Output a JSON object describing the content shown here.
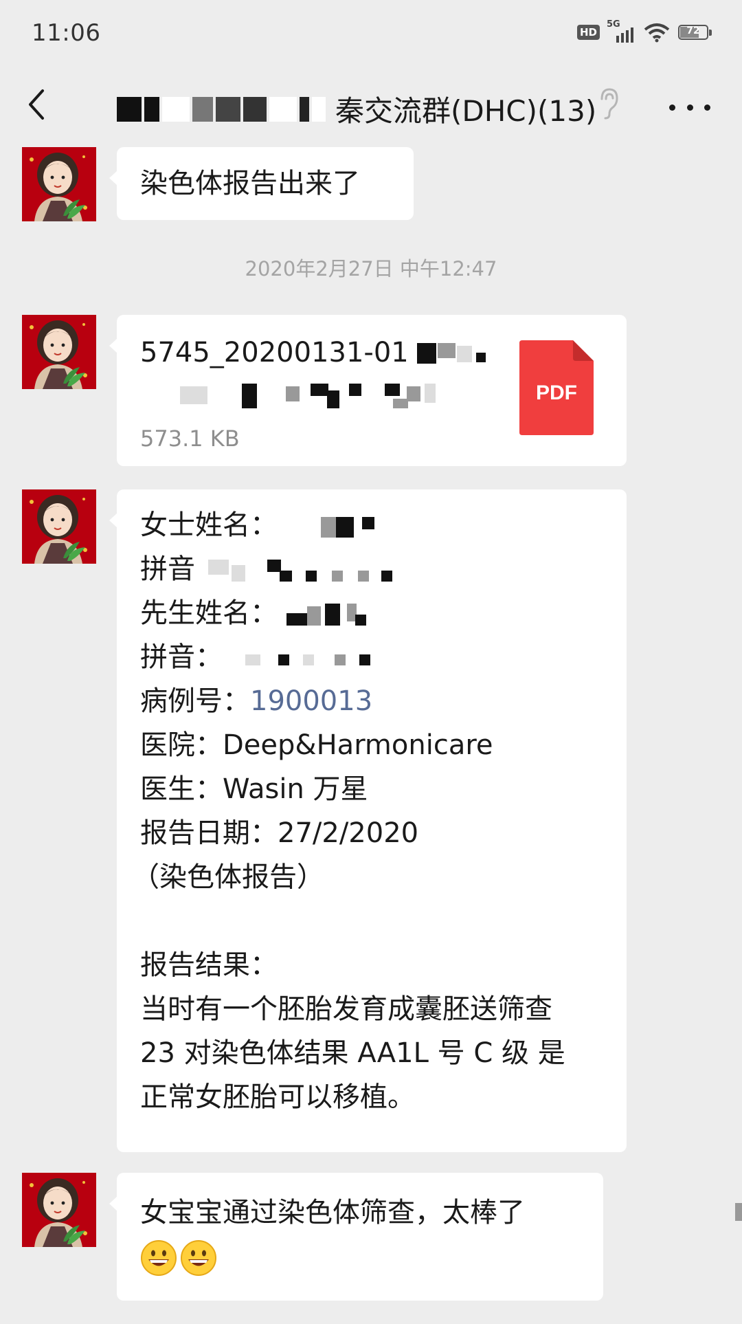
{
  "status_bar": {
    "time": "11:06",
    "hd_badge": "HD",
    "network": "5G",
    "battery_level": "72",
    "battery_fraction": 0.72
  },
  "nav": {
    "title_visible": "秦交流群(DHC)(13)",
    "back_icon": "chevron-left-icon",
    "ear_icon": "ear-icon",
    "more_icon": "more-dots-icon"
  },
  "messages": [
    {
      "type": "text",
      "text": "染色体报告出来了"
    },
    {
      "type": "timestamp",
      "text": "2020年2月27日 中午12:47"
    },
    {
      "type": "file",
      "file_name": "5745_20200131-01",
      "file_size": "573.1 KB",
      "file_type": "PDF"
    },
    {
      "type": "report",
      "lines": {
        "female_name_label": "女士姓名：",
        "pinyin1_label": "拼音",
        "male_name_label": "先生姓名：",
        "pinyin2_label": "拼音：",
        "case_label": "病例号：",
        "case_number": "1900013",
        "hospital": "医院：Deep&Harmonicare",
        "doctor": "医生：Wasin 万星",
        "report_date": "报告日期：27/2/2020",
        "report_type": "（染色体报告）",
        "result_label": "报告结果：",
        "result_1": "当时有一个胚胎发育成囊胚送筛查",
        "result_2": "23 对染色体结果 AA1L 号 C 级 是",
        "result_3": "正常女胚胎可以移植。"
      }
    },
    {
      "type": "text",
      "text": "女宝宝通过染色体筛查，太棒了",
      "emojis": [
        "grinning-face",
        "grinning-face"
      ]
    }
  ],
  "colors": {
    "background": "#ededed",
    "bubble": "#ffffff",
    "link": "#576b95",
    "pdf_red": "#f03e3e",
    "avatar_red": "#b8000f"
  }
}
